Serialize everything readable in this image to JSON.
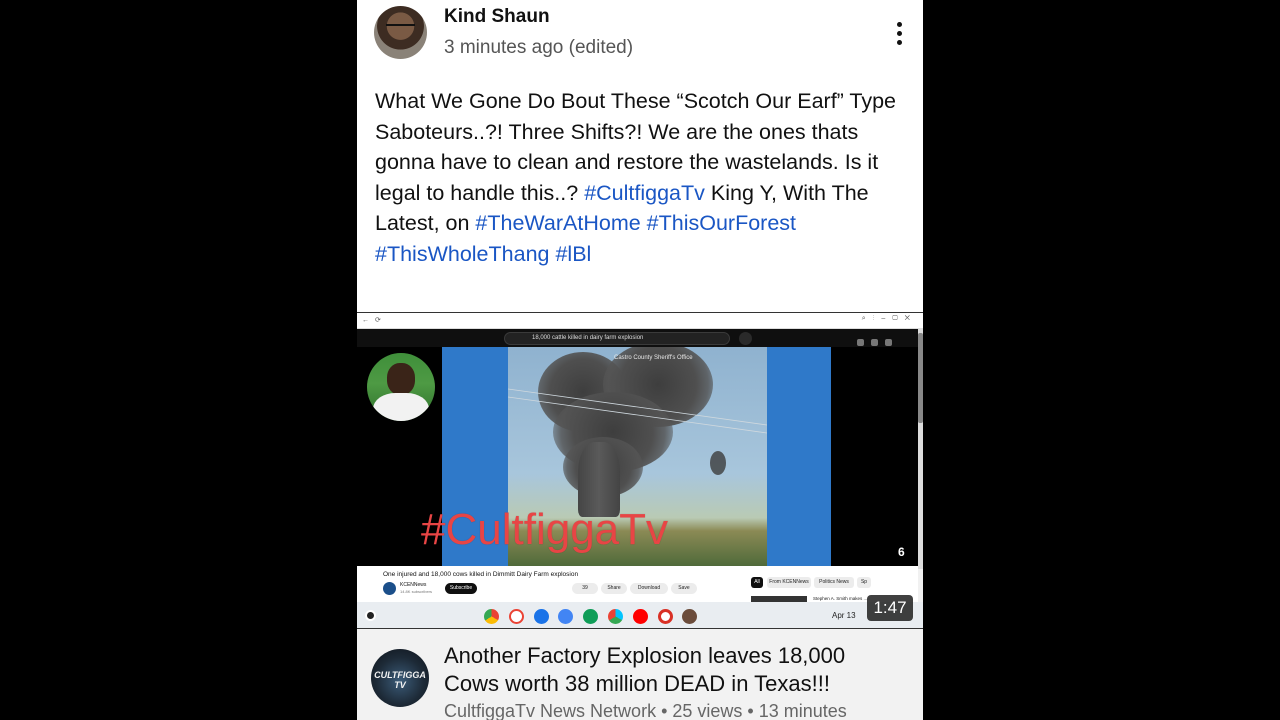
{
  "post": {
    "author": "Kind Shaun",
    "timestamp": "3 minutes ago (edited)",
    "text_line1": "What We Gone Do Bout These “Scotch Our Earf” Type Saboteurs..?!  Three Shifts?!  We are the ones thats gonna have to clean and restore the wastelands.  Is it legal to handle this..?",
    "hashtag1": "#CultfiggaTv",
    "text_mid": " King Y, With The Latest, on ",
    "hashtag2": "#TheWarAtHome",
    "hashtag3": "#ThisOurForest",
    "hashtag4": "#ThisWholeThang",
    "hashtag5": "#lBl"
  },
  "video": {
    "search_query": "18,000 cattle killed in dairy farm explosion",
    "credit": "Castro County Sheriff's Office",
    "watermark": "#CultfiggaTv",
    "yt_title": "One injured and 18,000 cows killed in Dimmitt Dairy Farm explosion",
    "yt_channel": "KCENNews",
    "yt_subs": "14.8K subscribers",
    "subscribe_label": "Subscribe",
    "likes": "39",
    "share_label": "Share",
    "download_label": "Download",
    "save_label": "Save",
    "chips": [
      "All",
      "From KCENNews",
      "Politics News",
      "Sp"
    ],
    "rec_text": "Stephen A. Smith makes ...",
    "logo": "6",
    "shelf_date": "Apr 13",
    "duration": "1:47"
  },
  "card": {
    "channel_logo_text": "CULTFIGGA TV",
    "title": "Another Factory Explosion leaves 18,000 Cows worth 38 million DEAD in Texas!!!",
    "meta": "CultfiggaTv News Network • 25 views • 13 minutes"
  },
  "colors": {
    "hashtag": "#1a56c4",
    "watermark": "#e84545"
  }
}
